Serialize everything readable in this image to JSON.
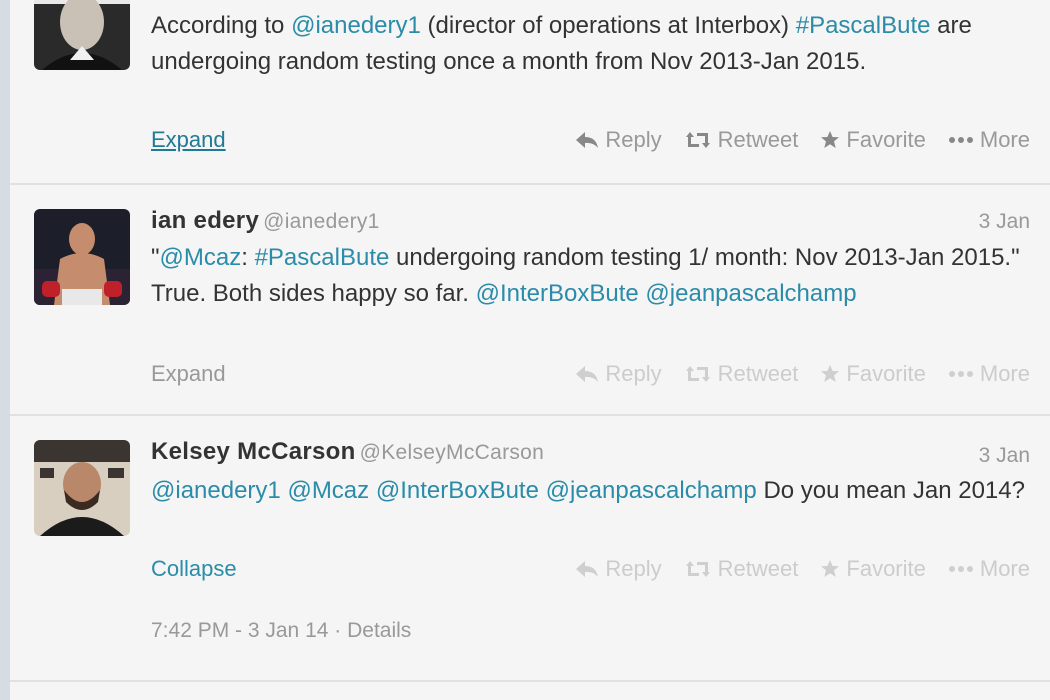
{
  "tweets": [
    {
      "text_parts": [
        "According to ",
        "@ianedery1",
        " (director of operations at Interbox) ",
        "#PascalBute",
        " are undergoing random testing once a month from Nov 2013-Jan 2015."
      ],
      "expand_label": "Expand",
      "actions": {
        "reply": "Reply",
        "retweet": "Retweet",
        "favorite": "Favorite",
        "more": "More"
      }
    },
    {
      "name": "ian edery",
      "handle": "@ianedery1",
      "time": "3 Jan",
      "text_parts": [
        "\"",
        "@Mcaz",
        ": ",
        "#PascalBute",
        " undergoing random testing 1/ month: Nov 2013-Jan 2015.\" True.  Both sides happy so far.  ",
        "@InterBoxBute",
        " ",
        "@jeanpascalchamp"
      ],
      "expand_label": "Expand",
      "actions": {
        "reply": "Reply",
        "retweet": "Retweet",
        "favorite": "Favorite",
        "more": "More"
      }
    },
    {
      "name": "Kelsey McCarson",
      "handle": "@KelseyMcCarson",
      "time": "3 Jan",
      "text_parts": [
        "@ianedery1",
        " ",
        "@Mcaz",
        " ",
        "@InterBoxBute",
        " ",
        "@jeanpascalchamp",
        " Do you mean Jan 2014?"
      ],
      "expand_label": "Collapse",
      "actions": {
        "reply": "Reply",
        "retweet": "Retweet",
        "favorite": "Favorite",
        "more": "More"
      },
      "meta": "7:42 PM - 3 Jan 14 · Details"
    }
  ],
  "colors": {
    "link": "#2a8ca8",
    "muted": "#999999",
    "faded": "#cccccc"
  }
}
